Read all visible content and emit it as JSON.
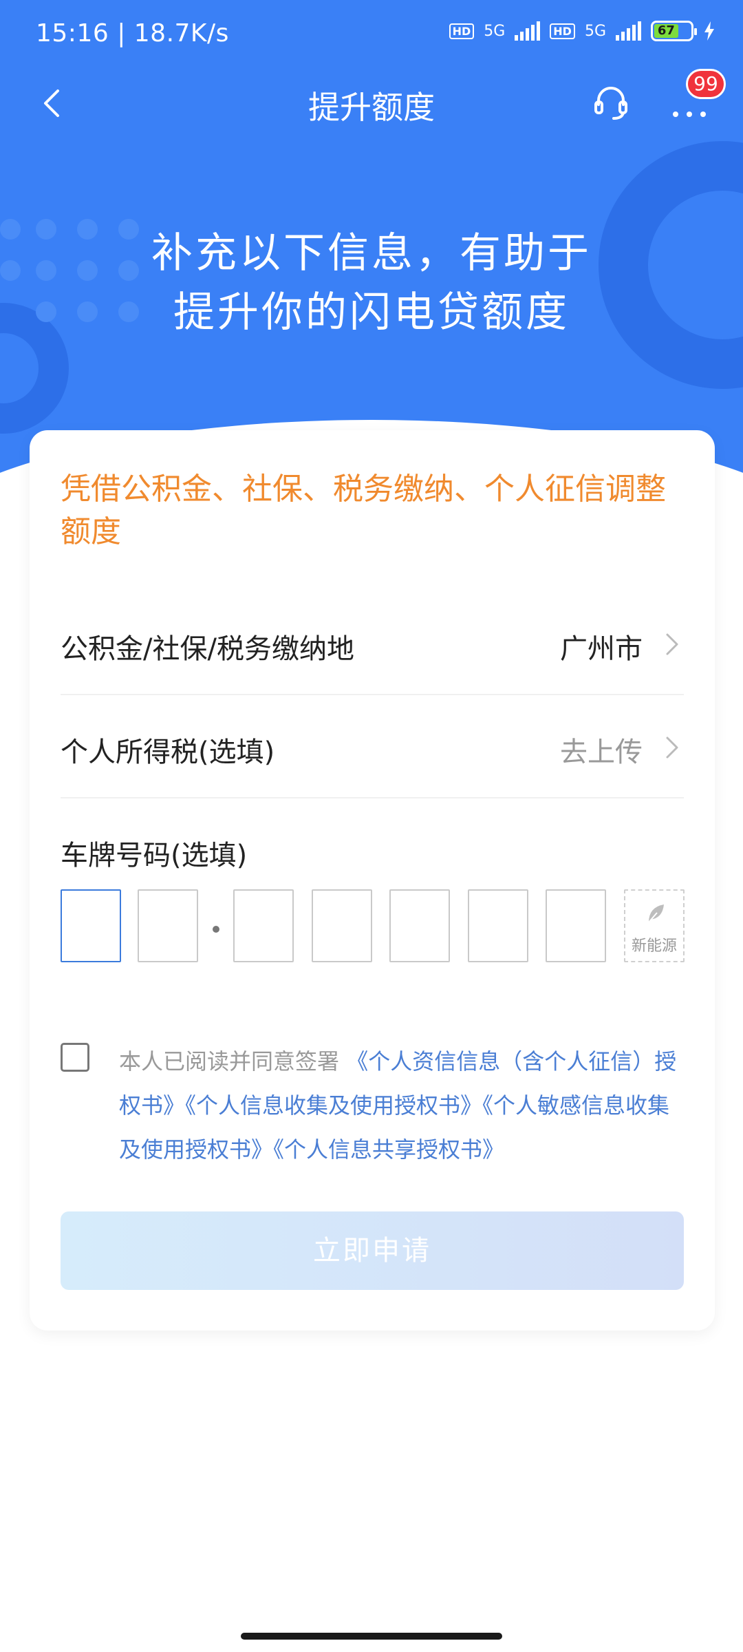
{
  "status_bar": {
    "time": "15:16 | 18.7K/s",
    "hd1": "HD",
    "net1": "5G",
    "hd2": "HD",
    "net2": "5G",
    "battery": "67"
  },
  "nav": {
    "title": "提升额度",
    "badge": "99"
  },
  "hero": {
    "line1": "补充以下信息，有助于",
    "line2": "提升你的闪电贷额度"
  },
  "card": {
    "tip": "凭借公积金、社保、税务缴纳、个人征信调整额度",
    "rows": [
      {
        "label": "公积金/社保/税务缴纳地",
        "value": "广州市"
      },
      {
        "label": "个人所得税(选填)",
        "value": "去上传"
      }
    ],
    "plate_label": "车牌号码(选填)",
    "new_energy": "新能源",
    "agreement": {
      "prefix": "本人已阅读并同意签署",
      "links": [
        "《个人资信信息（含个人征信）授权书》",
        "《个人信息收集及使用授权书》",
        "《个人敏感信息收集及使用授权书》",
        "《个人信息共享授权书》"
      ]
    },
    "submit_label": "立即申请"
  },
  "colors": {
    "primary": "#3a80f6",
    "accent_orange": "#f08a2e",
    "link": "#4a7ed4",
    "badge_red": "#f0333c"
  }
}
